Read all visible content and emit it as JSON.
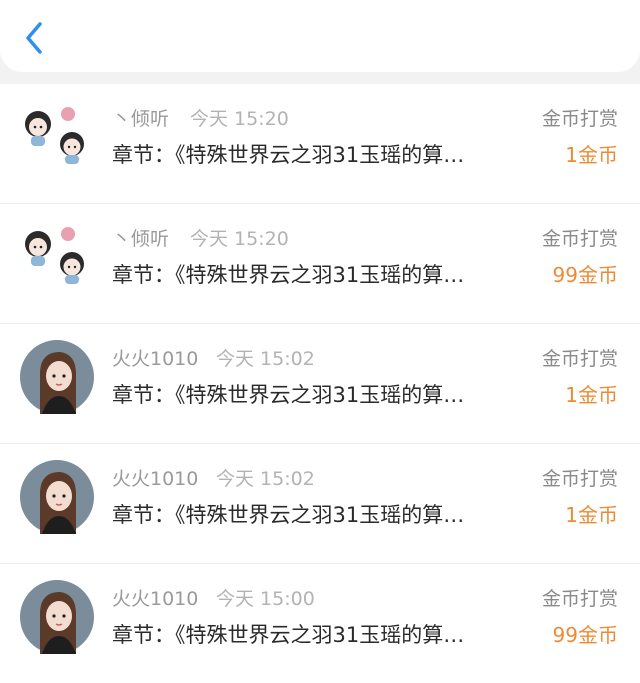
{
  "header": {
    "back_icon": "chevron-left-icon",
    "accent": "#2f8ff0"
  },
  "tips": [
    {
      "user": "丶倾听",
      "time": "今天 15:20",
      "type": "金币打赏",
      "chapter": "章节：《特殊世界云之羽31玉瑶的算…",
      "amount": "1金币"
    },
    {
      "user": "丶倾听",
      "time": "今天 15:20",
      "type": "金币打赏",
      "chapter": "章节：《特殊世界云之羽31玉瑶的算…",
      "amount": "99金币"
    },
    {
      "user": "火火1010",
      "time": "今天 15:02",
      "type": "金币打赏",
      "chapter": "章节：《特殊世界云之羽31玉瑶的算…",
      "amount": "1金币"
    },
    {
      "user": "火火1010",
      "time": "今天 15:02",
      "type": "金币打赏",
      "chapter": "章节：《特殊世界云之羽31玉瑶的算…",
      "amount": "1金币"
    },
    {
      "user": "火火1010",
      "time": "今天 15:00",
      "type": "金币打赏",
      "chapter": "章节：《特殊世界云之羽31玉瑶的算…",
      "amount": "99金币"
    }
  ],
  "colors": {
    "amount": "#ef8a33",
    "name": "#9a9a9a"
  }
}
